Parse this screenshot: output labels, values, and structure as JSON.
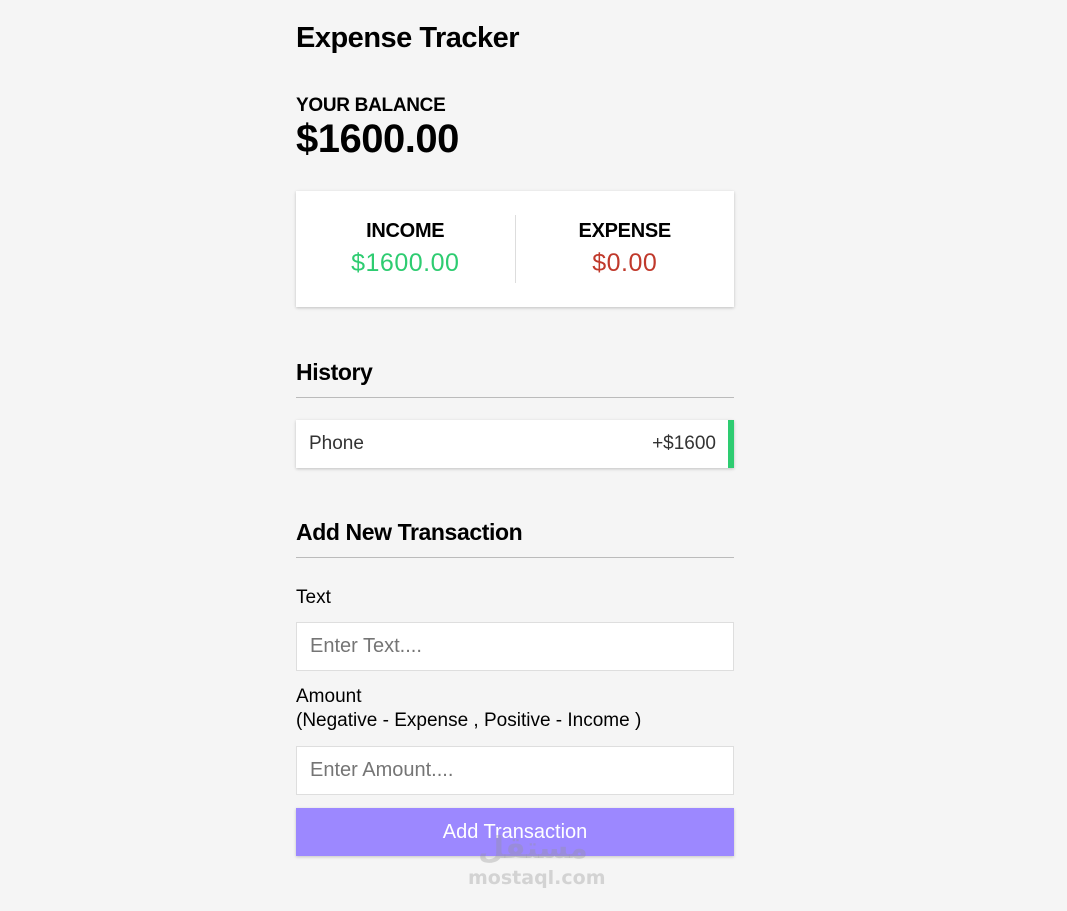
{
  "header": {
    "title": "Expense Tracker"
  },
  "balance": {
    "label": "YOUR BALANCE",
    "value": "$1600.00"
  },
  "summary": {
    "income_label": "INCOME",
    "income_value": "$1600.00",
    "expense_label": "EXPENSE",
    "expense_value": "$0.00",
    "income_color": "#2ecc71",
    "expense_color": "#c0392b"
  },
  "history": {
    "title": "History",
    "items": [
      {
        "text": "Phone",
        "amount": "+$1600",
        "type": "income",
        "border_color": "#2ecc71"
      }
    ]
  },
  "form": {
    "title": "Add New Transaction",
    "text_label": "Text",
    "text_placeholder": "Enter Text....",
    "text_value": "",
    "amount_label": "Amount",
    "amount_hint": "(Negative - Expense , Positive - Income )",
    "amount_placeholder": "Enter Amount....",
    "amount_value": "",
    "submit_label": "Add Transaction",
    "button_color": "#9c88ff"
  },
  "watermark": {
    "logo": "مستقل",
    "url": "mostaql.com"
  }
}
